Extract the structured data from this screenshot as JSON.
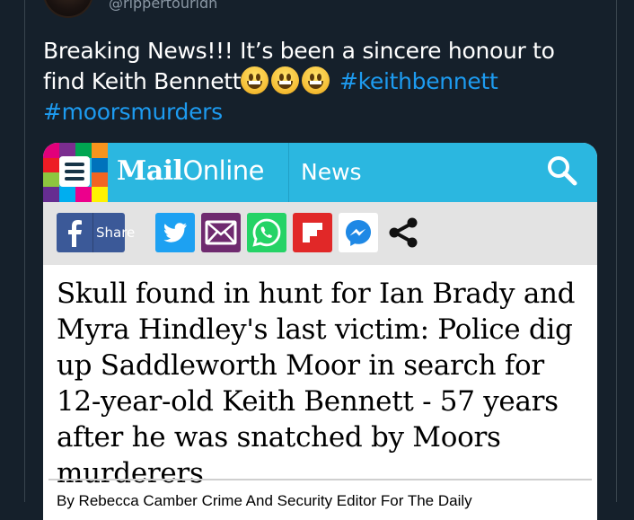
{
  "tweet": {
    "handle": "@rippertouridn",
    "text_part1": "Breaking News!!! It’s been a sincere honour to find Keith Bennett",
    "emojis": [
      "grinning-face",
      "grinning-face",
      "grinning-face"
    ],
    "hashtag1": "#keithbennett",
    "hashtag2": "#moorsmurders"
  },
  "article": {
    "site_name_bold": "Mail",
    "site_name_light": "Online",
    "section": "News",
    "share_label": "Share",
    "share_icons": [
      "facebook-icon",
      "twitter-icon",
      "email-icon",
      "whatsapp-icon",
      "flipboard-icon",
      "messenger-icon",
      "share-icon"
    ],
    "headline": "Skull found in hunt for Ian Brady and Myra Hindley's last victim: Police dig up Saddleworth Moor in search for 12-year-old Keith Bennett - 57 years after he was snatched by Moors murderers",
    "byline": "By Rebecca Camber Crime And Security Editor For The Daily"
  },
  "colors": {
    "background": "#15202b",
    "hashtag": "#1d9bf0",
    "mailonline_blue": "#2bb7e0",
    "facebook": "#3b5998",
    "twitter": "#1da1f2",
    "email": "#6f2a6f",
    "whatsapp": "#25d366",
    "flipboard": "#e12828"
  }
}
